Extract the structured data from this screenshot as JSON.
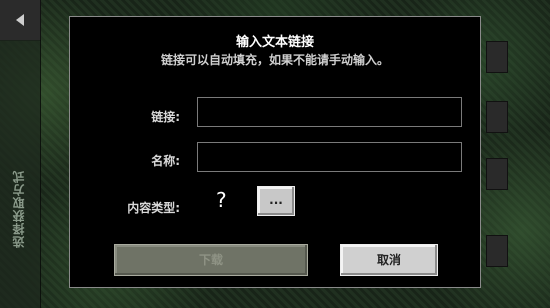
{
  "sidebar": {
    "vertical_label": "选择获取方式"
  },
  "dialog": {
    "title": "输入文本链接",
    "subtitle": "链接可以自动填充，如果不能请手动输入。",
    "link_label": "链接:",
    "link_value": "",
    "name_label": "名称:",
    "name_value": "",
    "content_type_label": "内容类型:",
    "content_type_value": "?",
    "more_button_label": "...",
    "download_button_label": "下载",
    "cancel_button_label": "取消"
  },
  "colors": {
    "dialog_bg": "#000000",
    "dialog_border": "#8a8a8a",
    "disabled_button": "#6f7366",
    "cancel_button": "#d0d0d0"
  }
}
